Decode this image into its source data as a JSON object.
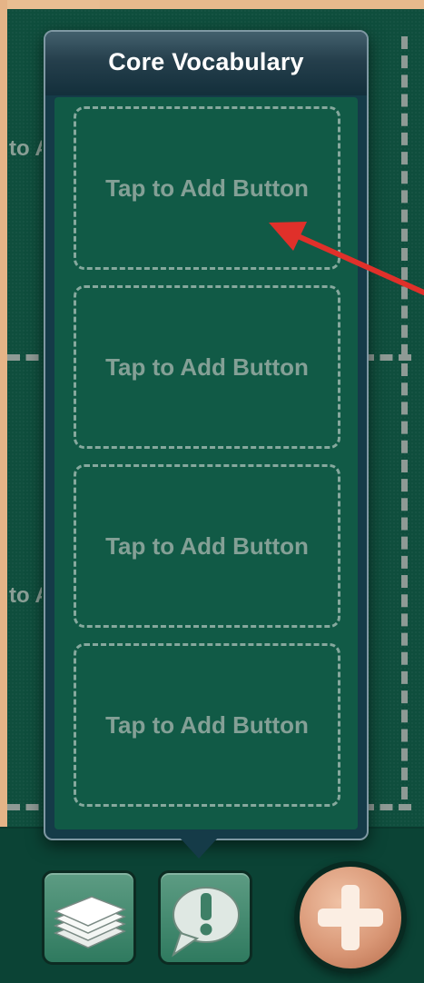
{
  "popover": {
    "title": "Core Vocabulary",
    "slots": [
      {
        "label": "Tap to Add Button"
      },
      {
        "label": "Tap to Add Button"
      },
      {
        "label": "Tap to Add Button"
      },
      {
        "label": "Tap to Add Button"
      }
    ]
  },
  "background": {
    "ghost_labels": [
      "to A",
      "to A"
    ]
  },
  "colors": {
    "board": "#0f4e3d",
    "popover_body": "#115a46",
    "annotation_arrow": "#e0302a",
    "plus_button": "#d99776"
  },
  "toolbar": {
    "buttons": [
      {
        "icon": "stacked-pages-icon"
      },
      {
        "icon": "speech-exclamation-icon"
      },
      {
        "icon": "plus-icon"
      }
    ]
  }
}
